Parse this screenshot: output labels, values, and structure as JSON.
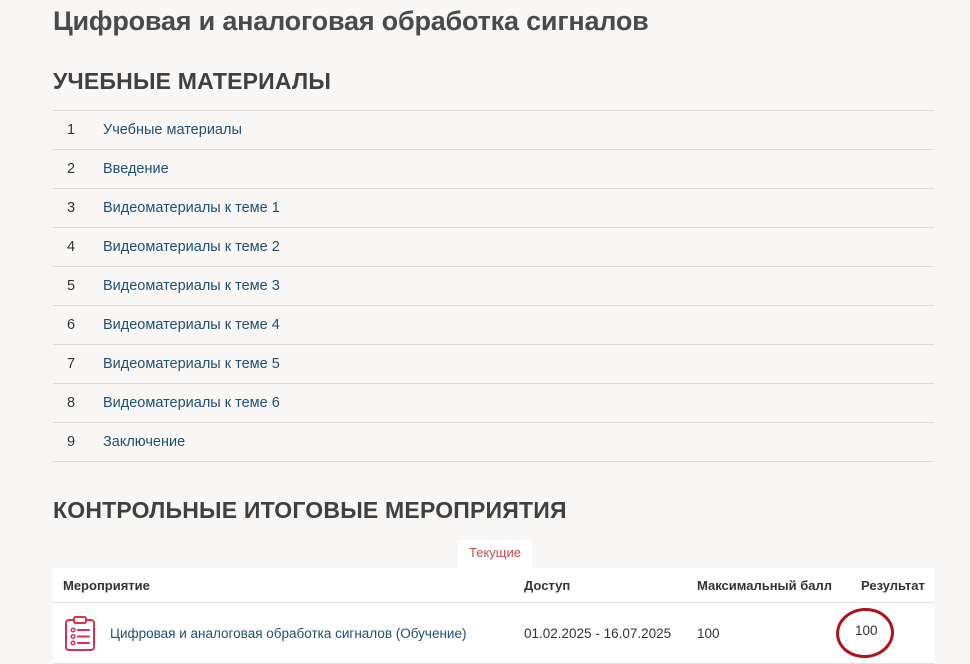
{
  "course": {
    "title": "Цифровая и аналоговая обработка сигналов"
  },
  "materials": {
    "heading": "УЧЕБНЫЕ МАТЕРИАЛЫ",
    "items": [
      {
        "num": "1",
        "label": "Учебные материалы"
      },
      {
        "num": "2",
        "label": "Введение"
      },
      {
        "num": "3",
        "label": "Видеоматериалы к теме 1"
      },
      {
        "num": "4",
        "label": "Видеоматериалы к теме 2"
      },
      {
        "num": "5",
        "label": "Видеоматериалы к теме 3"
      },
      {
        "num": "6",
        "label": "Видеоматериалы к теме 4"
      },
      {
        "num": "7",
        "label": "Видеоматериалы к теме 5"
      },
      {
        "num": "8",
        "label": "Видеоматериалы к теме 6"
      },
      {
        "num": "9",
        "label": "Заключение"
      }
    ]
  },
  "events": {
    "heading": "КОНТРОЛЬНЫЕ ИТОГОВЫЕ МЕРОПРИЯТИЯ",
    "tab_current": "Текущие",
    "columns": {
      "name": "Мероприятие",
      "access": "Доступ",
      "max_score": "Максимальный балл",
      "result": "Результат"
    },
    "rows": [
      {
        "icon": "clipboard-list-icon",
        "name": "Цифровая и аналоговая обработка сигналов (Обучение)",
        "access": "01.02.2025 - 16.07.2025",
        "max_score": "100",
        "result": "100"
      }
    ]
  },
  "colors": {
    "link": "#1f4f72",
    "tab_accent": "#c44b4b",
    "icon_accent": "#d6334f",
    "annotation_circle": "#b0121c"
  }
}
